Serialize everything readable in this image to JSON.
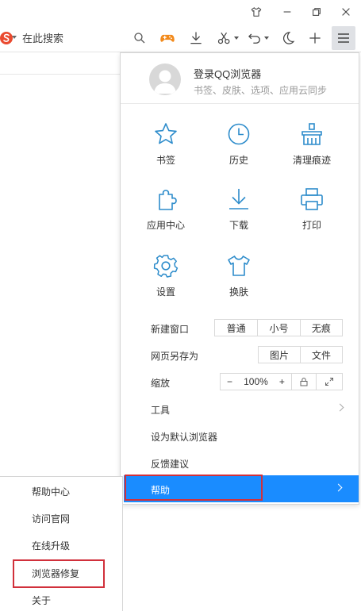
{
  "colors": {
    "accent": "#1a8cff",
    "highlight": "#d1303b",
    "icon": "#2d8ccb"
  },
  "search": {
    "placeholder": "在此搜索"
  },
  "profile": {
    "title": "登录QQ浏览器",
    "subtitle": "书签、皮肤、选项、应用云同步"
  },
  "grid": [
    {
      "label": "书签",
      "icon": "star-icon"
    },
    {
      "label": "历史",
      "icon": "clock-icon"
    },
    {
      "label": "清理痕迹",
      "icon": "broom-icon"
    },
    {
      "label": "应用中心",
      "icon": "puzzle-icon"
    },
    {
      "label": "下载",
      "icon": "download-icon"
    },
    {
      "label": "打印",
      "icon": "printer-icon"
    },
    {
      "label": "设置",
      "icon": "gear-icon"
    },
    {
      "label": "换肤",
      "icon": "shirt-icon"
    }
  ],
  "rows": {
    "new_window": {
      "label": "新建窗口",
      "options": [
        "普通",
        "小号",
        "无痕"
      ]
    },
    "save_as": {
      "label": "网页另存为",
      "options": [
        "图片",
        "文件"
      ]
    },
    "zoom": {
      "label": "缩放",
      "minus": "−",
      "value": "100%",
      "plus": "+"
    },
    "tools": {
      "label": "工具"
    },
    "default_browser": {
      "label": "设为默认浏览器"
    },
    "feedback": {
      "label": "反馈建议"
    },
    "help": {
      "label": "帮助"
    }
  },
  "submenu": [
    "帮助中心",
    "访问官网",
    "在线升级",
    "浏览器修复",
    "关于"
  ]
}
